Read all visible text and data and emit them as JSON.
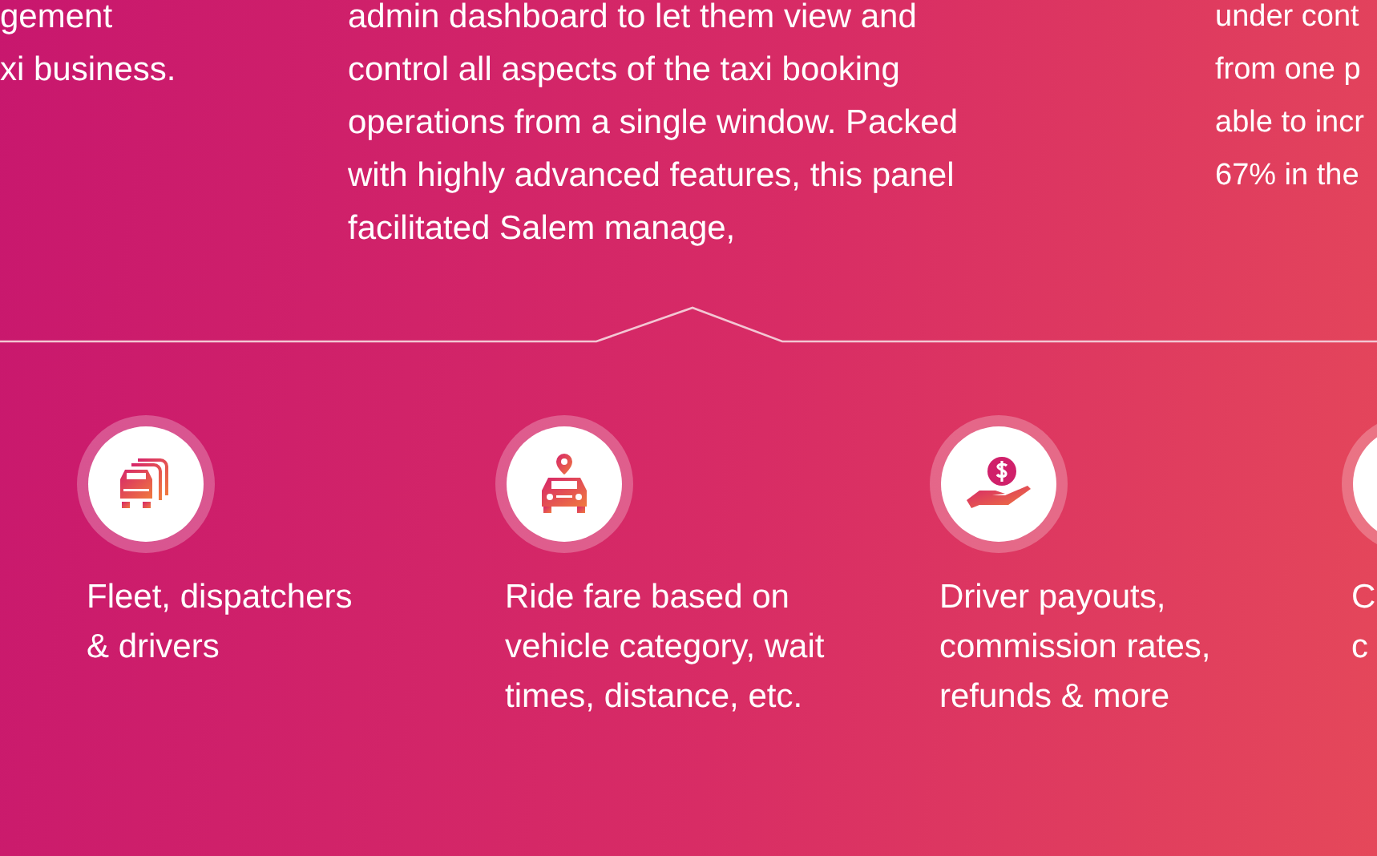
{
  "intro_columns": [
    {
      "lines": [
        "gement",
        "xi business."
      ]
    },
    {
      "lines": [
        "admin dashboard to let them view and",
        "control all aspects of the taxi booking",
        "operations from a single window. Packed",
        "with highly advanced features, this panel",
        "facilitated Salem manage,"
      ]
    },
    {
      "lines": [
        "under cont",
        "from one p",
        "able to incr",
        "67% in the"
      ]
    }
  ],
  "features": [
    {
      "kind": "fleet",
      "lines": [
        "Fleet, dispatchers",
        "& drivers"
      ]
    },
    {
      "kind": "fare",
      "lines": [
        "Ride fare based on",
        "vehicle category, wait",
        "times, distance, etc."
      ]
    },
    {
      "kind": "payout",
      "lines": [
        "Driver payouts,",
        "commission rates,",
        "refunds & more"
      ]
    },
    {
      "kind": "other",
      "lines": [
        "C",
        "c"
      ]
    }
  ]
}
